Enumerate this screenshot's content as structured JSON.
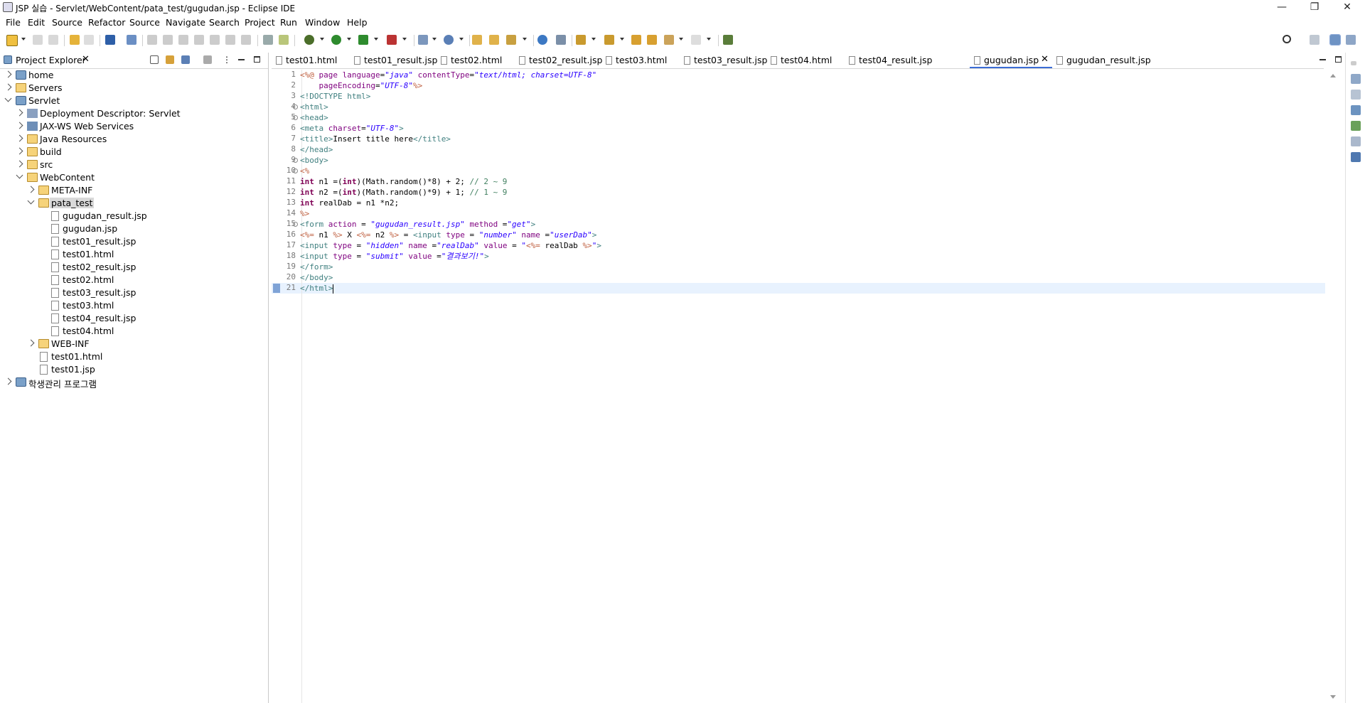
{
  "window": {
    "title": "JSP 실습 - Servlet/WebContent/pata_test/gugudan.jsp - Eclipse IDE"
  },
  "menu": [
    "File",
    "Edit",
    "Source",
    "Refactor",
    "Source",
    "Navigate",
    "Search",
    "Project",
    "Run",
    "Window",
    "Help"
  ],
  "explorer": {
    "title": "Project Explorer",
    "items": [
      {
        "label": "home"
      },
      {
        "label": "Servers"
      },
      {
        "label": "Servlet"
      },
      {
        "label": "Deployment Descriptor: Servlet"
      },
      {
        "label": "JAX-WS Web Services"
      },
      {
        "label": "Java Resources"
      },
      {
        "label": "build"
      },
      {
        "label": "src"
      },
      {
        "label": "WebContent"
      },
      {
        "label": "META-INF"
      },
      {
        "label": "pata_test"
      },
      {
        "label": "gugudan_result.jsp"
      },
      {
        "label": "gugudan.jsp"
      },
      {
        "label": "test01_result.jsp"
      },
      {
        "label": "test01.html"
      },
      {
        "label": "test02_result.jsp"
      },
      {
        "label": "test02.html"
      },
      {
        "label": "test03_result.jsp"
      },
      {
        "label": "test03.html"
      },
      {
        "label": "test04_result.jsp"
      },
      {
        "label": "test04.html"
      },
      {
        "label": "WEB-INF"
      },
      {
        "label": "test01.html"
      },
      {
        "label": "test01.jsp"
      },
      {
        "label": "학생관리 프로그램"
      }
    ]
  },
  "editor_tabs": [
    "test01.html",
    "test01_result.jsp",
    "test02.html",
    "test02_result.jsp",
    "test03.html",
    "test03_result.jsp",
    "test04.html",
    "test04_result.jsp",
    "gugudan.jsp",
    "gugudan_result.jsp"
  ],
  "active_tab": "gugudan.jsp",
  "code": {
    "line_numbers": [
      "1",
      "2",
      "3",
      "4",
      "5",
      "6",
      "7",
      "8",
      "9",
      "10",
      "11",
      "12",
      "13",
      "14",
      "15",
      "16",
      "17",
      "18",
      "19",
      "20",
      "21"
    ],
    "tokens": {
      "l1a": "<%@ ",
      "l1b": "page ",
      "l1c": "language",
      "l1d": "=",
      "l1e": "\"java\"",
      "l1f": " contentType",
      "l1g": "=",
      "l1h": "\"text/html; charset=UTF-8\"",
      "l2a": "    pageEncoding",
      "l2b": "=",
      "l2c": "\"UTF-8\"",
      "l2d": "%>",
      "l3": "<!DOCTYPE html>",
      "l4": "<html>",
      "l5": "<head>",
      "l6a": "<meta ",
      "l6b": "charset",
      "l6c": "=",
      "l6d": "\"UTF-8\"",
      "l6e": ">",
      "l7a": "<title>",
      "l7b": "Insert title here",
      "l7c": "</title>",
      "l8": "</head>",
      "l9": "<body>",
      "l10": "<%",
      "l11a": "int",
      "l11b": " n1 =(",
      "l11c": "int",
      "l11d": ")(Math.random()*8) + 2; ",
      "l11e": "// 2 ~ 9",
      "l12a": "int",
      "l12b": " n2 =(",
      "l12c": "int",
      "l12d": ")(Math.random()*9) + 1; ",
      "l12e": "// 1 ~ 9",
      "l13a": "int",
      "l13b": " realDab = n1 *n2;",
      "l14": "%>",
      "l15a": "<form ",
      "l15b": "action",
      " l15c": "",
      "l15d": " = ",
      "l15e": "\"gugudan_result.jsp\"",
      "l15f": " method",
      "l15g": " =",
      "l15h": "\"get\"",
      "l15i": ">",
      "l16a": "<%=",
      "l16b": " n1 ",
      "l16c": "%>",
      "l16d": " X ",
      "l16e": "<%=",
      "l16f": " n2 ",
      "l16g": "%>",
      "l16h": " = ",
      "l16i": "<input ",
      "l16j": "type",
      " l16k": "",
      "l16l": " = ",
      "l16m": "\"number\"",
      "l16n": " name",
      "l16o": " =",
      "l16p": "\"userDab\"",
      "l16q": ">",
      "l17a": "<input ",
      "l17b": "type",
      "l17c": " = ",
      "l17d": "\"hidden\"",
      "l17e": " name",
      "l17f": " =",
      "l17g": "\"realDab\"",
      "l17h": " value",
      "l17i": " = ",
      "l17j": "\"",
      "l17k": "<%=",
      "l17l": " realDab ",
      "l17m": "%>",
      "l17n": "\"",
      "l17o": ">",
      "l18a": "<input ",
      "l18b": "type",
      "l18c": " = ",
      "l18d": "\"submit\"",
      "l18e": " value",
      "l18f": " =",
      "l18g": "\"결과보기!\"",
      "l18h": ">",
      "l19": "</form>",
      "l20": "</body>",
      "l21": "</html>"
    }
  }
}
